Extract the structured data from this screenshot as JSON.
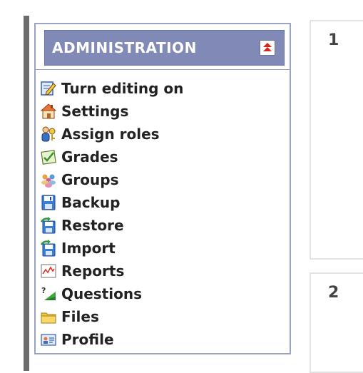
{
  "admin_block": {
    "title": "ADMINISTRATION",
    "collapse_icon": "double-chevron-up-icon",
    "items": [
      {
        "label": "Turn editing on",
        "icon": "edit-icon"
      },
      {
        "label": "Settings",
        "icon": "settings-icon"
      },
      {
        "label": "Assign roles",
        "icon": "assign-roles-icon"
      },
      {
        "label": "Grades",
        "icon": "grades-icon"
      },
      {
        "label": "Groups",
        "icon": "groups-icon"
      },
      {
        "label": "Backup",
        "icon": "backup-icon"
      },
      {
        "label": "Restore",
        "icon": "restore-icon"
      },
      {
        "label": "Import",
        "icon": "import-icon"
      },
      {
        "label": "Reports",
        "icon": "reports-icon"
      },
      {
        "label": "Questions",
        "icon": "questions-icon"
      },
      {
        "label": "Files",
        "icon": "folder-icon"
      },
      {
        "label": "Profile",
        "icon": "profile-icon"
      }
    ]
  },
  "sections": [
    {
      "number": "1"
    },
    {
      "number": "2"
    }
  ],
  "colors": {
    "header_bg": "#8189b7",
    "block_border": "#9aa3c6",
    "left_bar": "#6c6c6c",
    "collapse_arrow": "#d9261c"
  }
}
